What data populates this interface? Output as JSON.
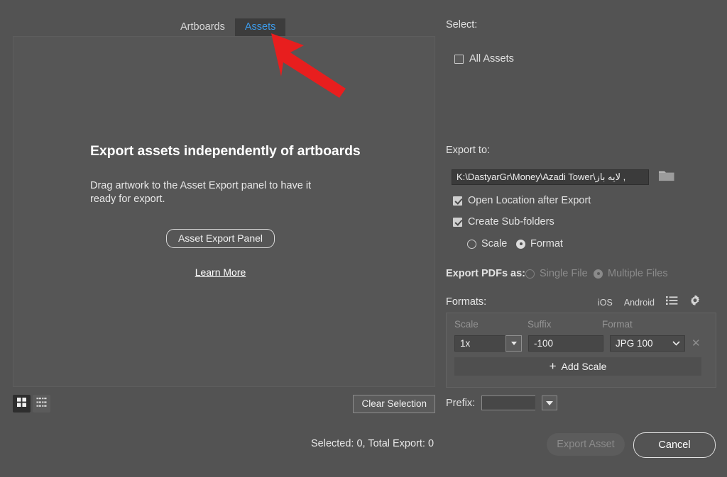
{
  "tabs": [
    {
      "label": "Artboards",
      "active": false
    },
    {
      "label": "Assets",
      "active": true
    }
  ],
  "canvas": {
    "headline": "Export assets independently of artboards",
    "subtext": "Drag artwork to the Asset Export panel to have it ready for export.",
    "panel_button": "Asset Export Panel",
    "learn_more": "Learn More"
  },
  "left_toolbar": {
    "grid_view_icon": "grid-view-icon",
    "list_view_icon": "list-view-icon",
    "clear_selection": "Clear Selection"
  },
  "right": {
    "select_label": "Select:",
    "all_assets_label": "All Assets",
    "all_assets_checked": false,
    "export_to_label": "Export to:",
    "path_value": "K:\\DastyarGr\\Money\\Azadi Tower\\لایه باز ,",
    "folder_icon": "folder-icon",
    "open_location_label": "Open Location after Export",
    "open_location_checked": true,
    "create_subfolders_label": "Create Sub-folders",
    "create_subfolders_checked": true,
    "subfolder_mode": [
      {
        "label": "Scale",
        "selected": false
      },
      {
        "label": "Format",
        "selected": true
      }
    ],
    "export_pdfs_label": "Export PDFs as:",
    "pdf_options": [
      {
        "label": "Single File",
        "selected": false
      },
      {
        "label": "Multiple Files",
        "selected": true
      }
    ],
    "formats_label": "Formats:",
    "preset_ios": "iOS",
    "preset_android": "Android",
    "list_icon": "list-presets-icon",
    "settings_icon": "gear-icon",
    "format_table": {
      "headers": [
        "Scale",
        "Suffix",
        "Format"
      ],
      "rows": [
        {
          "scale": "1x",
          "suffix": "-100",
          "format": "JPG 100",
          "remove_icon": "close-icon"
        }
      ],
      "add_scale_label": "Add Scale"
    },
    "prefix_label": "Prefix:",
    "prefix_value": ""
  },
  "bottom": {
    "status": "Selected: 0, Total Export: 0",
    "export_asset": "Export Asset",
    "cancel": "Cancel"
  },
  "annotation": {
    "arrow_color": "#e81e1e",
    "arrow_name": "red-pointer-arrow"
  },
  "colors": {
    "background": "#535353",
    "tab_active_bg": "#3c3c3c",
    "tab_active_text": "#3d9be9",
    "field_bg": "#3b3b3b"
  }
}
